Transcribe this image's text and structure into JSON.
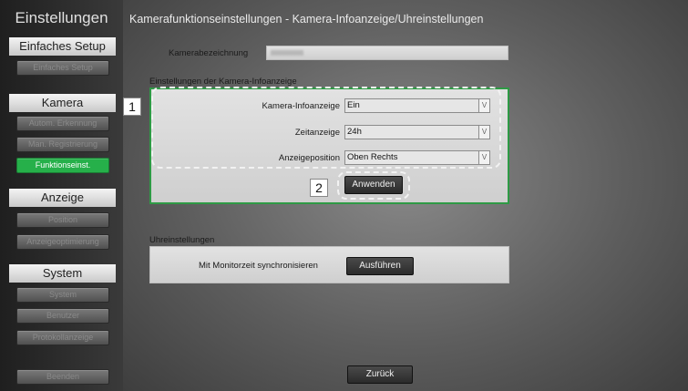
{
  "sidebar": {
    "title": "Einstellungen",
    "sections": [
      {
        "header": "Einfaches Setup",
        "items": [
          {
            "label": "Einfaches Setup",
            "active": false
          }
        ]
      },
      {
        "header": "Kamera",
        "items": [
          {
            "label": "Autom. Erkennung",
            "active": false
          },
          {
            "label": "Man. Registrierung",
            "active": false
          },
          {
            "label": "Funktionseinst.",
            "active": true
          }
        ]
      },
      {
        "header": "Anzeige",
        "items": [
          {
            "label": "Position",
            "active": false
          },
          {
            "label": "Anzeigeoptimierung",
            "active": false
          }
        ]
      },
      {
        "header": "System",
        "items": [
          {
            "label": "System",
            "active": false
          },
          {
            "label": "Benutzer",
            "active": false
          },
          {
            "label": "Protokollanzeige",
            "active": false
          }
        ]
      }
    ],
    "exit_label": "Beenden"
  },
  "main": {
    "title": "Kamerafunktionseinstellungen - Kamera-Infoanzeige/Uhreinstellungen",
    "camera_name_label": "Kamerabezeichnung",
    "camera_name_value": "",
    "info_section": {
      "title": "Einstellungen der Kamera-Infoanzeige",
      "fields": [
        {
          "label": "Kamera-Infoanzeige",
          "value": "Ein"
        },
        {
          "label": "Zeitanzeige",
          "value": "24h"
        },
        {
          "label": "Anzeigeposition",
          "value": "Oben Rechts"
        }
      ],
      "apply_label": "Anwenden"
    },
    "clock_section": {
      "title": "Uhreinstellungen",
      "sync_label": "Mit Monitorzeit synchronisieren",
      "run_label": "Ausführen"
    },
    "back_label": "Zurück"
  },
  "callouts": [
    "1",
    "2"
  ],
  "colors": {
    "active": "#26b04a",
    "panel_border": "#2e9a45"
  }
}
